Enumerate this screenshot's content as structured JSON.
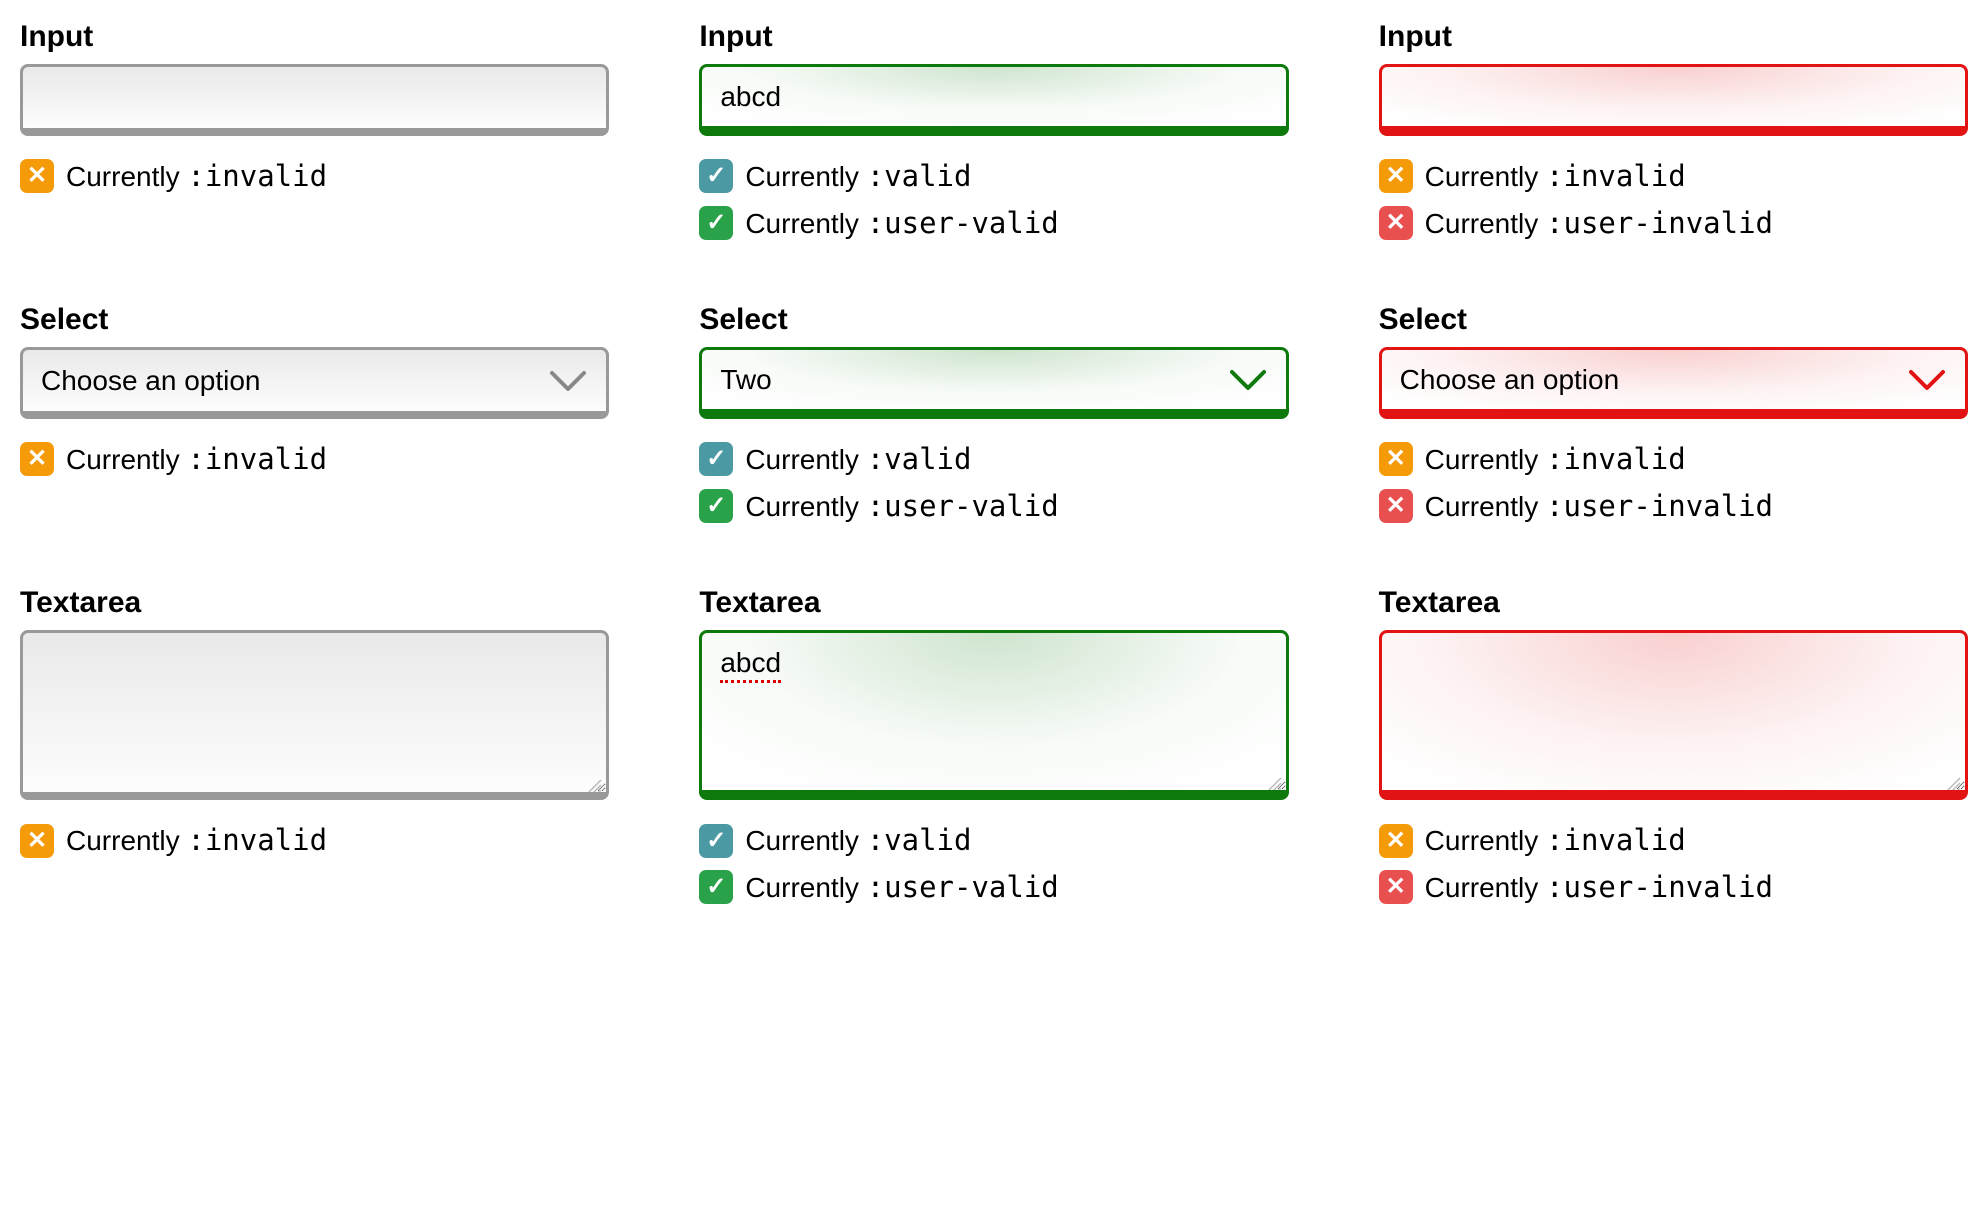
{
  "labels": {
    "input": "Input",
    "select": "Select",
    "textarea": "Textarea"
  },
  "status_prefix": "Currently ",
  "pseudo": {
    "invalid": ":invalid",
    "valid": ":valid",
    "user_valid": ":user-valid",
    "user_invalid": ":user-invalid"
  },
  "icons": {
    "orange_x": "❎",
    "teal_check": "☑️",
    "green_check": "✅",
    "red_x": "❌"
  },
  "icon_emoji": {
    "orange_x": "✖️",
    "teal_check": "✔️",
    "green_check": "✔️",
    "red_x": "✖️"
  },
  "columns": [
    {
      "state": "neutral",
      "input": {
        "value": ""
      },
      "select": {
        "value": "Choose an option"
      },
      "textarea": {
        "value": ""
      },
      "status": [
        {
          "icon": "orange_x",
          "pseudo": "invalid"
        }
      ]
    },
    {
      "state": "valid",
      "input": {
        "value": "abcd"
      },
      "select": {
        "value": "Two"
      },
      "textarea": {
        "value": "abcd"
      },
      "status": [
        {
          "icon": "teal_check",
          "pseudo": "valid"
        },
        {
          "icon": "green_check",
          "pseudo": "user_valid"
        }
      ]
    },
    {
      "state": "invalid",
      "input": {
        "value": ""
      },
      "select": {
        "value": "Choose an option"
      },
      "textarea": {
        "value": ""
      },
      "status": [
        {
          "icon": "orange_x",
          "pseudo": "invalid"
        },
        {
          "icon": "red_x",
          "pseudo": "user_invalid"
        }
      ]
    }
  ],
  "badge_colors": {
    "orange_x": {
      "bg": "#f59b0a",
      "fg": "#ffffff"
    },
    "teal_check": {
      "bg": "#4b9aa3",
      "fg": "#ffffff"
    },
    "green_check": {
      "bg": "#2aa24a",
      "fg": "#ffffff"
    },
    "red_x": {
      "bg": "#e85050",
      "fg": "#ffffff"
    }
  }
}
